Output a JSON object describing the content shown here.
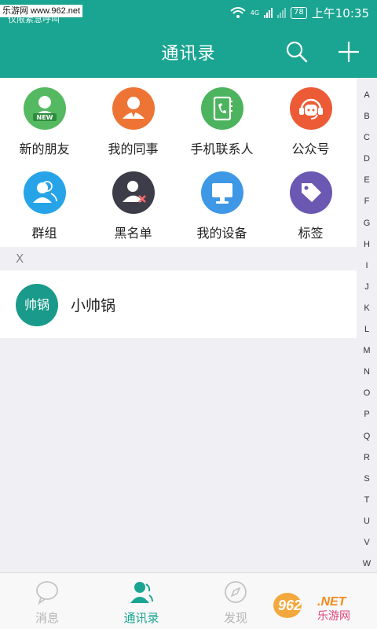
{
  "status": {
    "watermark": "乐游网 www.962.net",
    "hint": "仅限紧急呼叫",
    "network": "4G",
    "battery": "78",
    "time": "上午10:35"
  },
  "header": {
    "title": "通讯录"
  },
  "grid": [
    {
      "label": "新的朋友",
      "icon": "new-friend-icon",
      "color": "#55b961",
      "badge": "NEW"
    },
    {
      "label": "我的同事",
      "icon": "colleague-icon",
      "color": "#ed7435"
    },
    {
      "label": "手机联系人",
      "icon": "phone-contacts-icon",
      "color": "#4cb35e"
    },
    {
      "label": "公众号",
      "icon": "official-account-icon",
      "color": "#ec5b36"
    },
    {
      "label": "群组",
      "icon": "group-icon",
      "color": "#27a4e8"
    },
    {
      "label": "黑名单",
      "icon": "blacklist-icon",
      "color": "#3d3d49"
    },
    {
      "label": "我的设备",
      "icon": "device-icon",
      "color": "#3e98e6"
    },
    {
      "label": "标签",
      "icon": "tag-icon",
      "color": "#6a58b3"
    }
  ],
  "section": {
    "letter": "X"
  },
  "contact": {
    "avatar_text": "帅锅",
    "name": "小帅锅"
  },
  "index": [
    "A",
    "B",
    "C",
    "D",
    "E",
    "F",
    "G",
    "H",
    "I",
    "J",
    "K",
    "L",
    "M",
    "N",
    "O",
    "P",
    "Q",
    "R",
    "S",
    "T",
    "U",
    "V",
    "W"
  ],
  "nav": [
    {
      "label": "消息",
      "icon": "message-icon"
    },
    {
      "label": "通讯录",
      "icon": "contacts-icon",
      "active": true
    },
    {
      "label": "发现",
      "icon": "compass-icon"
    }
  ],
  "watermark_logo": "962.NET 乐游网"
}
